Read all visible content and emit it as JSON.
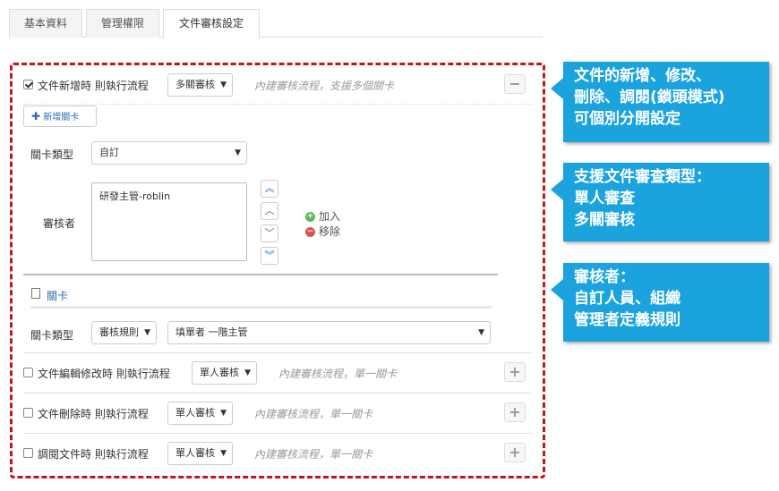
{
  "tabs": [
    {
      "label": "基本資料",
      "active": false
    },
    {
      "label": "管理權限",
      "active": false
    },
    {
      "label": "文件審核設定",
      "active": true
    }
  ],
  "flows": {
    "create": {
      "label": "文件新增時 則執行流程",
      "checked": true,
      "select": "多關審核",
      "hint": "內建審核流程，支援多個關卡",
      "toggle": "−"
    },
    "edit": {
      "label": "文件編輯修改時 則執行流程",
      "checked": false,
      "select": "單人審核",
      "hint": "內建審核流程，單一關卡",
      "toggle": "+"
    },
    "delete": {
      "label": "文件刪除時 則執行流程",
      "checked": false,
      "select": "單人審核",
      "hint": "內建審核流程，單一關卡",
      "toggle": "+"
    },
    "read": {
      "label": "調閱文件時 則執行流程",
      "checked": false,
      "select": "單人審核",
      "hint": "內建審核流程，單一關卡",
      "toggle": "+"
    }
  },
  "stage_editor": {
    "add_stage_label": "新增關卡",
    "type_label": "關卡類型",
    "type_value": "自訂",
    "reviewer_label": "審核者",
    "reviewers": "研發主管-roblin",
    "add_label": "加入",
    "remove_label": "移除"
  },
  "stage": {
    "title": "關卡",
    "type_label": "關卡類型",
    "type_value": "審核規則",
    "rule_value": "填單者 一階主管"
  },
  "callouts": [
    {
      "lines": [
        "文件的新增、修改、",
        "刪除、調閱(鎖頭模式)",
        "可個別分開設定"
      ]
    },
    {
      "lines": [
        "支援文件審查類型：",
        "單人審查",
        "多關審核"
      ]
    },
    {
      "lines": [
        "審核者：",
        "自訂人員、組織",
        "管理者定義規則"
      ]
    }
  ],
  "colors": {
    "frame": "#c0161c",
    "callout": "#1aa3dd",
    "link": "#2a6cb3"
  }
}
